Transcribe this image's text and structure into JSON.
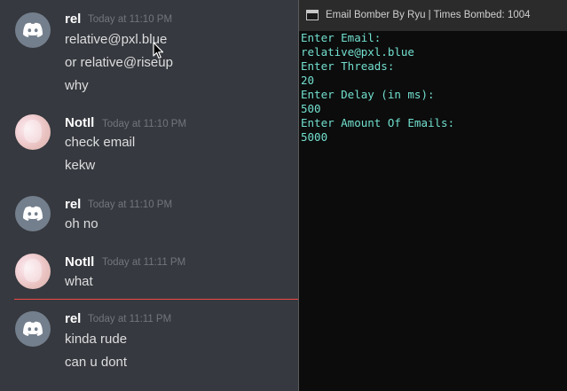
{
  "colors": {
    "chat_background": "#36393f",
    "username": "#ffffff",
    "message_text": "#dcddde",
    "timestamp": "#72767d",
    "new_message_divider": "#f04747",
    "discord_default_avatar": "#747f8d",
    "console_background": "#0c0c0c",
    "console_titlebar": "#2b2b2b",
    "console_text": "#72e0cf"
  },
  "chat": {
    "groups": [
      {
        "author": "rel",
        "timestamp": "Today at 11:10 PM",
        "avatar_icon": "discord-logo-icon",
        "lines": [
          "relative@pxl.blue",
          "or relative@riseup",
          "why"
        ]
      },
      {
        "author": "NotIl",
        "timestamp": "Today at 11:10 PM",
        "avatar_icon": "anime-avatar-image",
        "lines": [
          "check email",
          "kekw"
        ]
      },
      {
        "author": "rel",
        "timestamp": "Today at 11:10 PM",
        "avatar_icon": "discord-logo-icon",
        "lines": [
          "oh no"
        ]
      },
      {
        "author": "NotIl",
        "timestamp": "Today at 11:11 PM",
        "avatar_icon": "anime-avatar-image",
        "lines": [
          "what"
        ]
      },
      {
        "author": "rel",
        "timestamp": "Today at 11:11 PM",
        "avatar_icon": "discord-logo-icon",
        "lines": [
          "kinda rude",
          "can u dont"
        ]
      }
    ]
  },
  "console": {
    "title": "Email Bomber By Ryu | Times Bombed: 1004",
    "lines": [
      "Enter Email:",
      "relative@pxl.blue",
      "Enter Threads:",
      "20",
      "Enter Delay (in ms):",
      "500",
      "Enter Amount Of Emails:",
      "5000"
    ]
  }
}
